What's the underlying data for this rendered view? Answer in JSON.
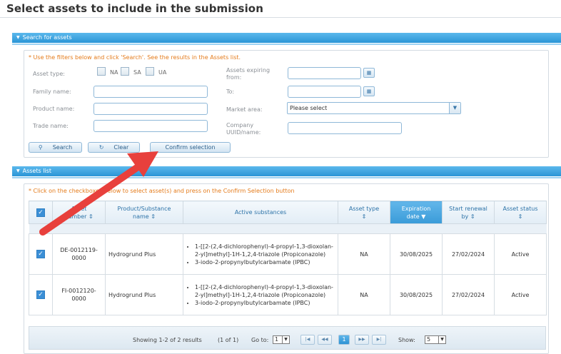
{
  "page": {
    "title": "Select assets to include in the submission"
  },
  "search": {
    "section_title": "Search for assets",
    "hint": "* Use the filters below and click 'Search'. See the results in the Assets list.",
    "asset_type_label": "Asset type:",
    "asset_type_options": [
      "NA",
      "SA",
      "UA"
    ],
    "family_name_label": "Family name:",
    "product_name_label": "Product name:",
    "trade_name_label": "Trade name:",
    "assets_expiring_label_1": "Assets expiring",
    "assets_expiring_label_2": "from:",
    "to_label": "To:",
    "market_area_label": "Market area:",
    "market_area_value": "Please select",
    "company_label_1": "Company",
    "company_label_2": "UUID/name:",
    "search_button": "Search",
    "clear_button": "Clear",
    "confirm_button": "Confirm selection"
  },
  "assets": {
    "section_title": "Assets list",
    "hint": "* Click on the checkboxes below to select asset(s) and press on the Confirm Selection button",
    "columns": {
      "asset_number_1": "Asset",
      "asset_number_2": "number",
      "product_1": "Product/Substance",
      "product_2": "name",
      "active": "Active substances",
      "asset_type": "Asset type",
      "expiration_1": "Expiration",
      "expiration_2": "date",
      "renewal_1": "Start renewal",
      "renewal_2": "by",
      "status": "Asset status"
    },
    "rows": [
      {
        "asset_number_1": "DE-0012119-",
        "asset_number_2": "0000",
        "product": "Hydrogrund Plus",
        "substances": [
          "1-[[2-(2,4-dichlorophenyl)-4-propyl-1,3-dioxolan-2-yl]methyl]-1H-1,2,4-triazole (Propiconazole)",
          "3-iodo-2-propynylbutylcarbamate (IPBC)"
        ],
        "asset_type": "NA",
        "expiration": "30/08/2025",
        "renewal": "27/02/2024",
        "status": "Active"
      },
      {
        "asset_number_1": "FI-0012120-",
        "asset_number_2": "0000",
        "product": "Hydrogrund Plus",
        "substances": [
          "1-[[2-(2,4-dichlorophenyl)-4-propyl-1,3-dioxolan-2-yl]methyl]-1H-1,2,4-triazole (Propiconazole)",
          "3-iodo-2-propynylbutylcarbamate (IPBC)"
        ],
        "asset_type": "NA",
        "expiration": "30/08/2025",
        "renewal": "27/02/2024",
        "status": "Active"
      }
    ]
  },
  "pager": {
    "showing": "Showing 1-2 of 2 results",
    "pages": "(1 of 1)",
    "goto_label": "Go to:",
    "goto_value": "1",
    "current_page": "1",
    "show_label": "Show:",
    "show_value": "5"
  },
  "colors": {
    "section_bar": "#2a95d6",
    "hint": "#e47b1b",
    "annotation_arrow": "#e8403c"
  }
}
